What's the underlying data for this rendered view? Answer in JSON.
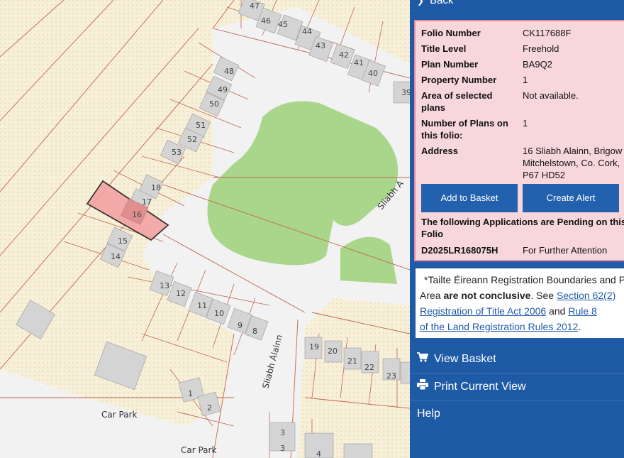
{
  "nav": {
    "back_label": "Back"
  },
  "folio": {
    "rows": [
      {
        "label": "Folio Number",
        "value": "CK117688F"
      },
      {
        "label": "Title Level",
        "value": "Freehold"
      },
      {
        "label": "Plan Number",
        "value": "BA9Q2"
      },
      {
        "label": "Property Number",
        "value": "1"
      },
      {
        "label": "Area of selected plans",
        "value": "Not available."
      },
      {
        "label": "Number of Plans on this folio:",
        "value": "1"
      },
      {
        "label": "Address",
        "value_lines": [
          "16 Sliabh Alainn, Brigow",
          "Mitchelstown, Co. Cork,",
          "P67 HD52"
        ]
      }
    ],
    "add_to_basket_label": "Add to Basket",
    "create_alert_label": "Create Alert",
    "pending_title": "The following Applications are Pending on this Folio",
    "pending": [
      {
        "id": "D2025LR168075H",
        "status": "For Further Attention"
      }
    ]
  },
  "notice": {
    "text_1": "*Tailte Éireann Registration Boundaries and P",
    "text_2": "Area ",
    "text_bold": "are not conclusive",
    "text_3": ". See ",
    "link_1": "Section 62(2)",
    "link_2": "Registration of Title Act 2006",
    "text_4": " and ",
    "link_3": "Rule 8",
    "link_4": "of the Land Registration Rules 2012",
    "text_5": "."
  },
  "menu": {
    "view_basket_label": "View Basket",
    "print_label": "Print Current View",
    "help_label": "Help"
  },
  "map": {
    "house_numbers": [
      "47",
      "46",
      "45",
      "44",
      "43",
      "42",
      "41",
      "40",
      "39",
      "48",
      "49",
      "50",
      "51",
      "52",
      "53",
      "18",
      "17",
      "16",
      "15",
      "14",
      "13",
      "12",
      "11",
      "10",
      "9",
      "8",
      "19",
      "20",
      "21",
      "22",
      "23",
      "1",
      "2",
      "3",
      "3",
      "4"
    ],
    "car_park_label": "Car Park",
    "street_label": "Sliabh Álainn",
    "street_label_2": "Sliabh Á"
  },
  "colors": {
    "sidebar": "#1f5aa6",
    "highlight": "#f4a3a3",
    "green": "#a9d68a"
  }
}
